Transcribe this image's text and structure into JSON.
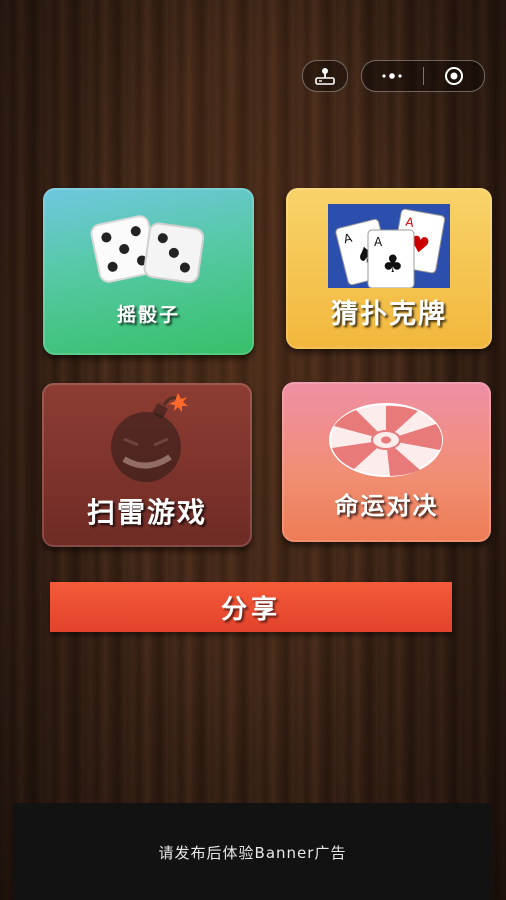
{
  "capsule": {
    "left_icon": "joystick-icon",
    "menu_icon": "more-dots-icon",
    "close_icon": "record-close-icon"
  },
  "tiles": [
    {
      "label": "摇骰子",
      "icon": "dice-icon",
      "color": "#36c068"
    },
    {
      "label": "猜扑克牌",
      "icon": "playing-cards-icon",
      "color": "#f2b73c"
    },
    {
      "label": "扫雷游戏",
      "icon": "bomb-face-icon",
      "color": "#6f2b25"
    },
    {
      "label": "命运对决",
      "icon": "wheel-icon",
      "color": "#f08e72"
    }
  ],
  "share_label": "分享",
  "banner_text": "请发布后体验Banner广告"
}
